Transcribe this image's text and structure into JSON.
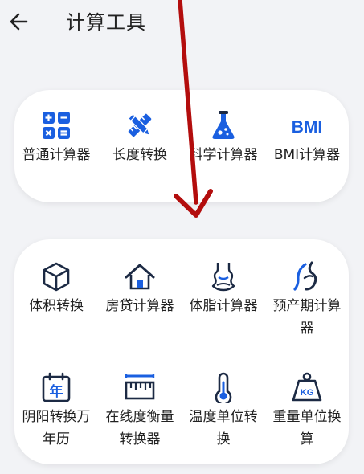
{
  "header": {
    "title": "计算工具"
  },
  "colors": {
    "accent": "#1a5fe0",
    "dark": "#1c2a44",
    "annotation_arrow": "#b30d0d"
  },
  "card1": {
    "items": [
      {
        "label": "普通计算器",
        "icon": "calculator-icon"
      },
      {
        "label": "长度转换",
        "icon": "pencil-ruler-icon"
      },
      {
        "label": "科学计算器",
        "icon": "flask-icon"
      },
      {
        "label": "BMI计算器",
        "icon": "bmi-icon",
        "icon_text": "BMI"
      }
    ]
  },
  "card2": {
    "items": [
      {
        "label": "体积转换",
        "icon": "cube-icon"
      },
      {
        "label": "房贷计算器",
        "icon": "house-icon"
      },
      {
        "label": "体脂计算器",
        "icon": "swimsuit-icon"
      },
      {
        "label": "预产期计算器",
        "icon": "pregnancy-icon"
      },
      {
        "label": "阴阳转换万年历",
        "icon": "calendar-icon",
        "icon_text": "年"
      },
      {
        "label": "在线度衡量转换器",
        "icon": "ruler-icon"
      },
      {
        "label": "温度单位转换",
        "icon": "thermometer-icon"
      },
      {
        "label": "重量单位换算",
        "icon": "weight-icon",
        "icon_text": "KG"
      }
    ]
  }
}
